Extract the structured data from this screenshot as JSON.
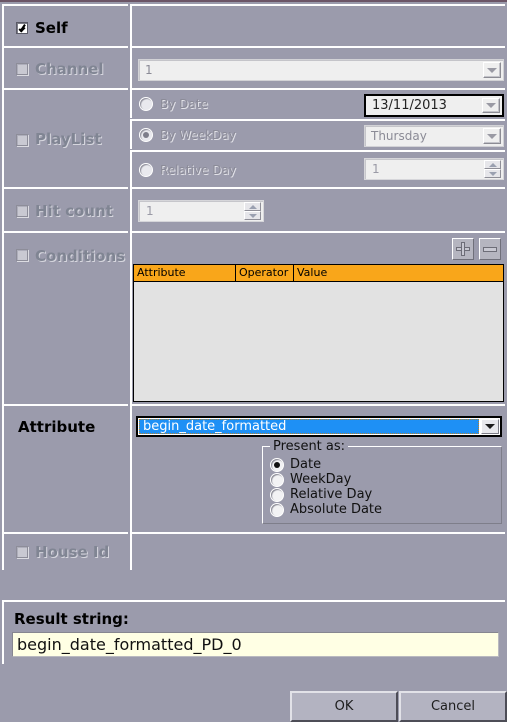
{
  "dialog": {
    "background_color": "#9b9bac",
    "accent_color": "#f9a61a",
    "highlight_color": "#1e90f5"
  },
  "rows": {
    "self": {
      "label": "Self",
      "checked": true,
      "enabled": true
    },
    "channel": {
      "label": "Channel",
      "checked": false,
      "enabled": false,
      "combo_value": "1"
    },
    "playlist": {
      "label": "PlayList",
      "checked": false,
      "enabled": false,
      "options": [
        {
          "label": "By Date",
          "selected": false,
          "value": "13/11/2013"
        },
        {
          "label": "By WeekDay",
          "selected": true,
          "value": "Thursday"
        },
        {
          "label": "Relative Day",
          "selected": false,
          "value": "1"
        }
      ]
    },
    "hit_count": {
      "label": "Hit count",
      "checked": false,
      "enabled": false,
      "value": "1"
    },
    "conditions": {
      "label": "Conditions",
      "checked": false,
      "enabled": false,
      "add_button": "+",
      "remove_button": "-",
      "columns": [
        "Attribute",
        "Operator",
        "Value"
      ],
      "rows": []
    },
    "attribute": {
      "label": "Attribute",
      "enabled": true,
      "selected_value": "begin_date_formatted",
      "present_as": {
        "title": "Present as:",
        "options": [
          {
            "label": "Date",
            "selected": true
          },
          {
            "label": "WeekDay",
            "selected": false
          },
          {
            "label": "Relative Day",
            "selected": false
          },
          {
            "label": "Absolute Date",
            "selected": false
          }
        ]
      }
    },
    "house_id": {
      "label": "House Id",
      "checked": false,
      "enabled": false
    }
  },
  "result": {
    "label": "Result string:",
    "value": "begin_date_formatted_PD_0"
  },
  "buttons": {
    "ok": "OK",
    "cancel": "Cancel"
  },
  "icons": {
    "chevron_down": "chevron-down-icon",
    "spin_up": "spinner-up-icon",
    "spin_down": "spinner-down-icon"
  }
}
